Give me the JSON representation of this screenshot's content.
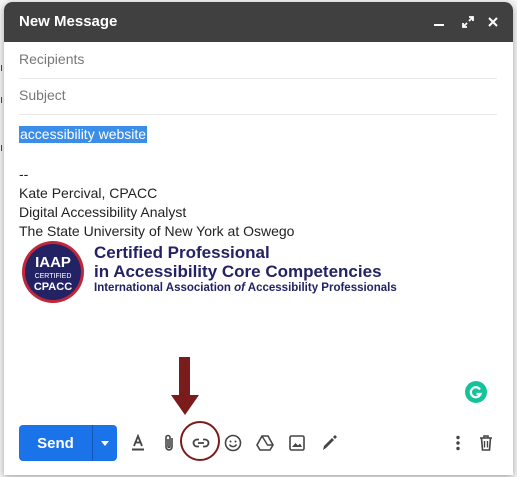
{
  "window": {
    "title": "New Message",
    "minimize_icon": "minimize-icon",
    "popout_icon": "popout-icon",
    "close_icon": "close-icon"
  },
  "fields": {
    "recipients_placeholder": "Recipients",
    "subject_placeholder": "Subject"
  },
  "body": {
    "selected_text": "accessibility website",
    "signature": {
      "separator": "--",
      "name": "Kate Percival, CPACC",
      "role": "Digital Accessibility Analyst",
      "organization": "The State University of New York at Oswego"
    },
    "badge": {
      "logo_text_1": "IAAP",
      "logo_text_2": "CERTIFIED",
      "logo_text_3": "CPACC",
      "line1": "Certified Professional",
      "line2": "in Accessibility Core Competencies",
      "line3_part1": "International Association ",
      "line3_of": "of",
      "line3_part2": " Accessibility Professionals"
    }
  },
  "toolbar": {
    "send_label": "Send",
    "icons": [
      "formatting-icon",
      "attach-icon",
      "insert-link-icon",
      "emoji-icon",
      "drive-icon",
      "photo-icon",
      "signature-icon",
      "more-options-icon",
      "discard-icon"
    ]
  },
  "colors": {
    "titlebar": "#404040",
    "send_button": "#1a73e8",
    "selection": "#3b8ee8",
    "badge_navy": "#232264",
    "annotation": "#7a1c1c",
    "grammarly": "#15c39a"
  }
}
